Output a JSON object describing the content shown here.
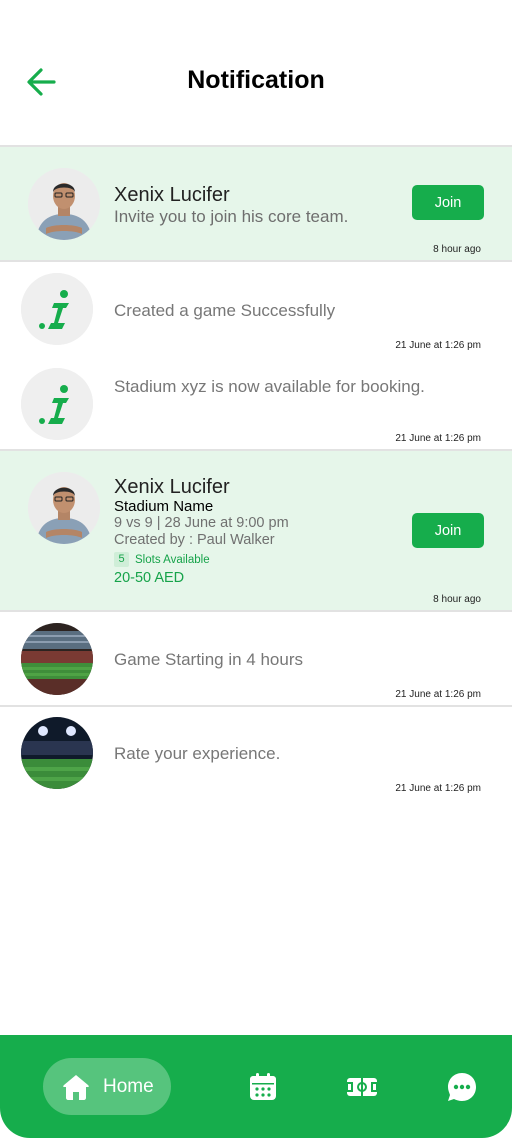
{
  "header": {
    "title": "Notification"
  },
  "notifications": {
    "invite": {
      "name": "Xenix Lucifer",
      "message": "Invite you to join his core team.",
      "button": "Join",
      "time": "8 hour ago"
    },
    "created": {
      "message": "Created a game Successfully",
      "time": "21 June at 1:26 pm"
    },
    "stadium_available": {
      "message": "Stadium xyz is now available for booking.",
      "time": "21 June at 1:26 pm"
    },
    "game_invite": {
      "name": "Xenix Lucifer",
      "stadium": "Stadium Name",
      "details": "9 vs 9 | 28 June at 9:00 pm",
      "created_by": "Created by : Paul Walker",
      "slots_count": "5",
      "slots_label": "Slots Available",
      "price": "20-50 AED",
      "button": "Join",
      "time": "8 hour ago"
    },
    "starting": {
      "message": "Game Starting in 4 hours",
      "time": "21 June at 1:26 pm"
    },
    "rate": {
      "message": "Rate your experience.",
      "time": "21 June at 1:26 pm"
    }
  },
  "nav": {
    "home_label": "Home"
  },
  "colors": {
    "accent": "#16ad4c",
    "highlight_bg": "#e6f6ea"
  }
}
